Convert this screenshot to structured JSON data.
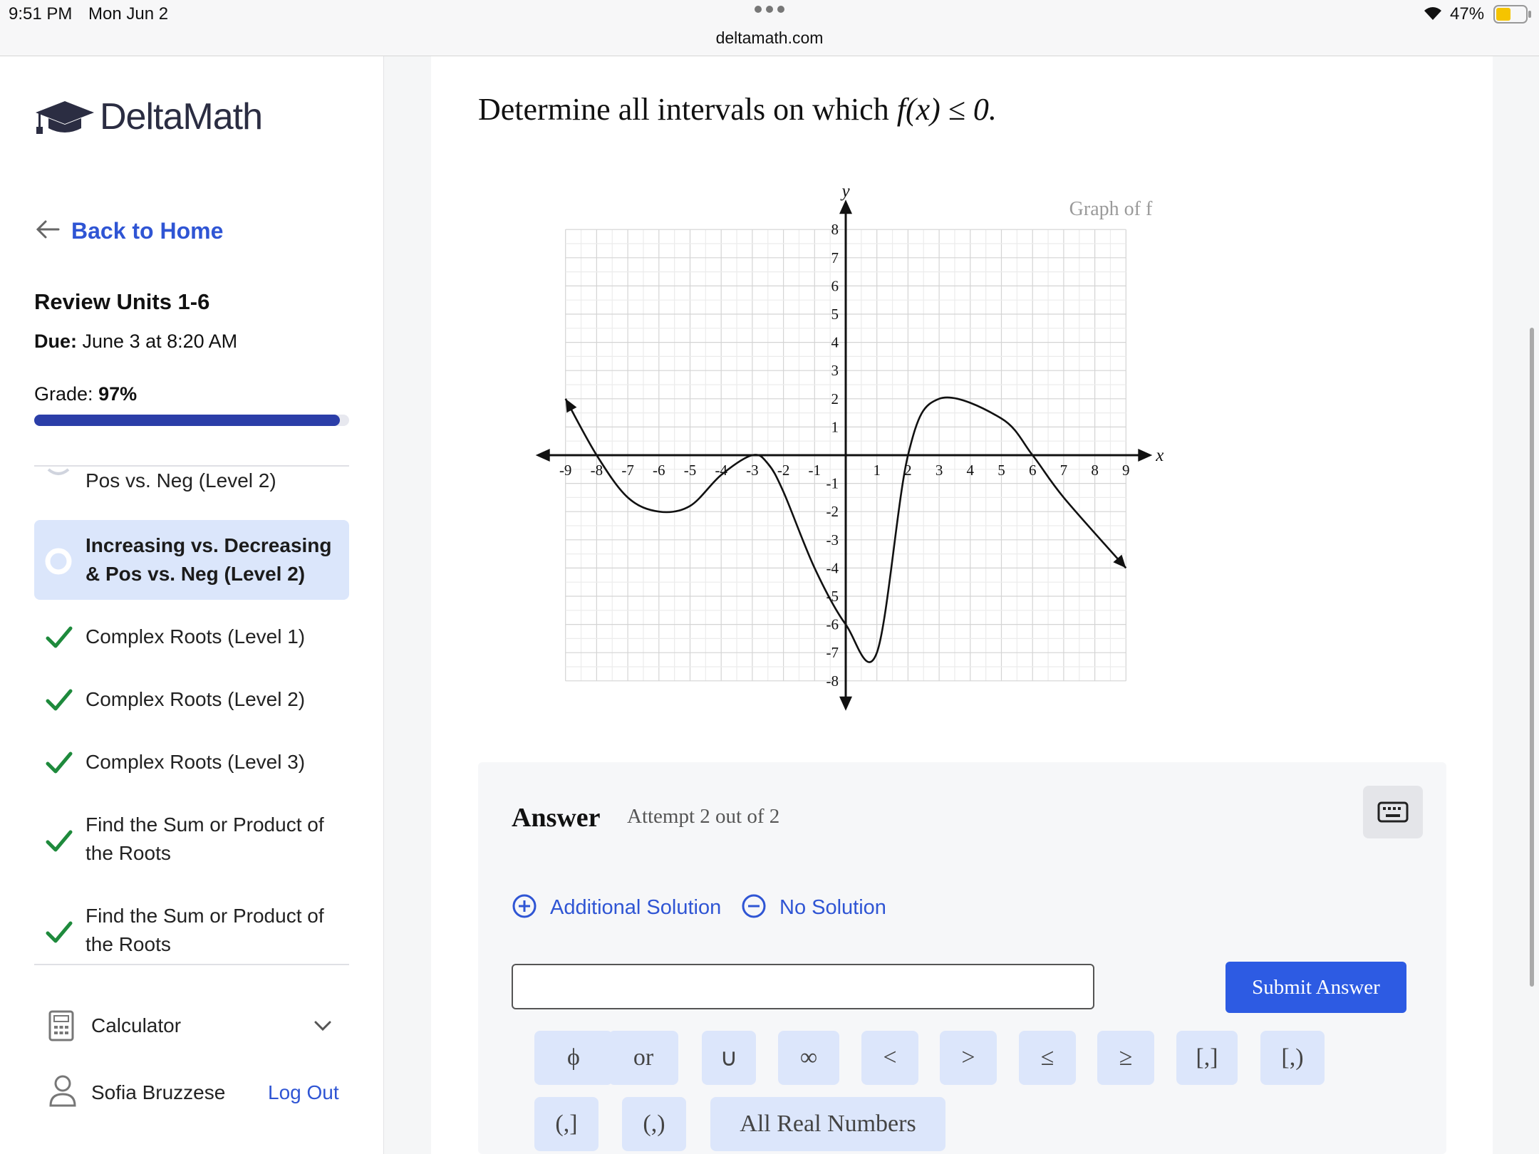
{
  "status_bar": {
    "time": "9:51 PM",
    "date": "Mon Jun 2",
    "url": "deltamath.com",
    "battery": "47%"
  },
  "sidebar": {
    "logo": "DeltaMath",
    "back_link": "Back to Home",
    "assignment_title": "Review Units 1-6",
    "due_label": "Due:",
    "due_value": "June 3 at 8:20 AM",
    "grade_label": "Grade:",
    "grade_value": "97%",
    "grade_progress": 0.97,
    "lessons": [
      {
        "label": "Pos vs. Neg (Level 2)",
        "state": "partial"
      },
      {
        "label": "Increasing vs. Decreasing & Pos vs. Neg (Level 2)",
        "state": "active"
      },
      {
        "label": "Complex Roots (Level 1)",
        "state": "complete"
      },
      {
        "label": "Complex Roots (Level 2)",
        "state": "complete"
      },
      {
        "label": "Complex Roots (Level 3)",
        "state": "complete"
      },
      {
        "label": "Find the Sum or Product of the Roots",
        "state": "complete"
      },
      {
        "label": "Find the Sum or Product of the Roots",
        "state": "complete"
      }
    ],
    "calculator_label": "Calculator",
    "user_name": "Sofia Bruzzese",
    "logout_label": "Log Out"
  },
  "question": {
    "prefix": "Determine all intervals on which ",
    "expression": "f(x) ≤ 0."
  },
  "chart_data": {
    "type": "line",
    "title": "Graph of f",
    "xlabel": "x",
    "ylabel": "y",
    "xlim": [
      -9,
      9
    ],
    "ylim": [
      -8,
      8
    ],
    "x_ticks": [
      -9,
      -8,
      -7,
      -6,
      -5,
      -4,
      -3,
      -2,
      -1,
      1,
      2,
      3,
      4,
      5,
      6,
      7,
      8,
      9
    ],
    "y_ticks": [
      -8,
      -7,
      -6,
      -5,
      -4,
      -3,
      -2,
      -1,
      1,
      2,
      3,
      4,
      5,
      6,
      7,
      8
    ],
    "grid": true,
    "series": [
      {
        "x": [
          -9,
          -8,
          -7,
          -6,
          -5,
          -4,
          -3,
          -2.5,
          -2,
          -1,
          0,
          1,
          2,
          3,
          5,
          6,
          7,
          9
        ],
        "y": [
          2,
          0,
          -1.5,
          -2,
          -1.8,
          -0.7,
          0,
          -0.3,
          -1.3,
          -4,
          -6,
          -7,
          0,
          2,
          1.3,
          0,
          -1.5,
          -4
        ]
      }
    ]
  },
  "answer": {
    "heading": "Answer",
    "attempt": "Attempt 2 out of 2",
    "additional_solution": "Additional Solution",
    "no_solution": "No Solution",
    "input_value": "",
    "submit_label": "Submit Answer",
    "keys_row1": [
      "ϕ",
      "or",
      "∪",
      "∞",
      "<",
      ">",
      "≤",
      "≥",
      "[,]",
      "[,)"
    ],
    "keys_row2": [
      "(,]",
      "(,)",
      "All Real Numbers"
    ]
  }
}
